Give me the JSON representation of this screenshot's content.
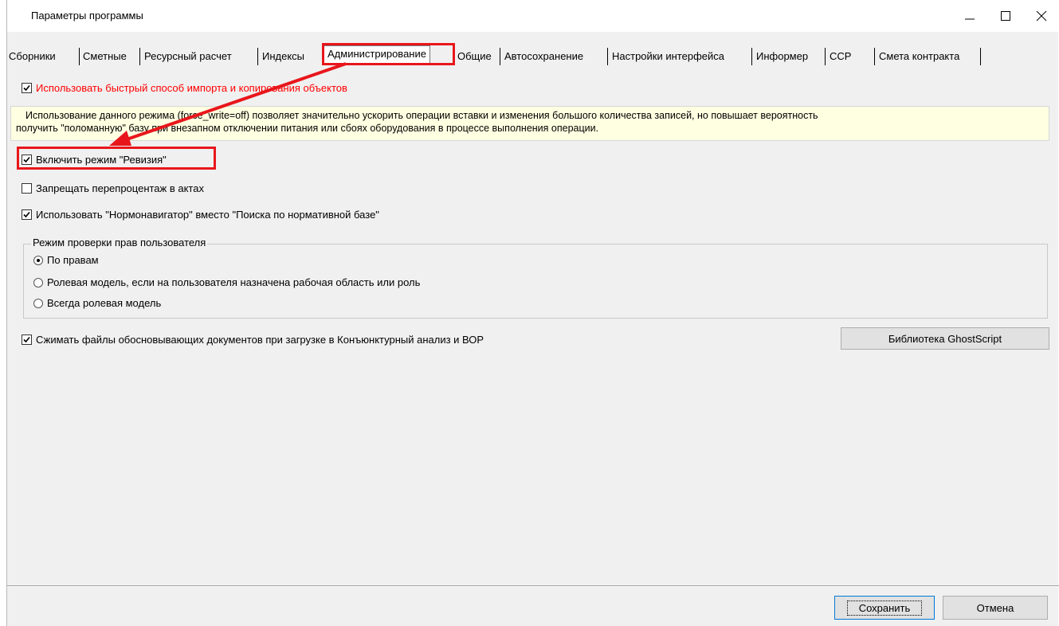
{
  "window": {
    "title": "Параметры программы"
  },
  "tabs": [
    {
      "label": "Сборники"
    },
    {
      "label": "Сметные"
    },
    {
      "label": "Ресурсный расчет"
    },
    {
      "label": "Индексы"
    },
    {
      "label": "Администрирование",
      "active": true
    },
    {
      "label": "Общие"
    },
    {
      "label": "Автосохранение"
    },
    {
      "label": "Настройки интерфейса"
    },
    {
      "label": "Информер"
    },
    {
      "label": "ССР"
    },
    {
      "label": "Смета контракта"
    }
  ],
  "options": {
    "fast_import": {
      "label": "Использовать быстрый способ импорта и копирования объектов",
      "checked": true,
      "color": "#ff0000"
    },
    "fast_import_note": {
      "line1": "Использование данного режима (force_write=off) позволяет значительно ускорить операции вставки и изменения большого количества записей, но повышает вероятность",
      "line2": "получить \"поломанную\" базу при внезапном отключении питания или сбоях оборудования в процессе выполнения операции."
    },
    "revision_mode": {
      "label": "Включить режим \"Ревизия\"",
      "checked": true
    },
    "forbid_reprocent": {
      "label": "Запрещать перепроцентаж в актах",
      "checked": false
    },
    "use_normonavigator": {
      "label": "Использовать \"Нормонавигатор\" вместо \"Поиска по нормативной базе\"",
      "checked": true
    }
  },
  "rights_group": {
    "title": "Режим проверки прав пользователя",
    "options": [
      {
        "label": "По правам",
        "selected": true
      },
      {
        "label": "Ролевая модель, если на пользователя назначена рабочая область или роль",
        "selected": false
      },
      {
        "label": "Всегда ролевая модель",
        "selected": false
      }
    ]
  },
  "compress": {
    "label": "Сжимать файлы обосновывающих документов при загрузке в Конъюнктурный анализ и ВОР",
    "checked": true
  },
  "buttons": {
    "ghostscript": "Библиотека GhostScript",
    "save": "Сохранить",
    "cancel": "Отмена"
  },
  "annotation": {
    "highlight_color": "#e8161b"
  }
}
